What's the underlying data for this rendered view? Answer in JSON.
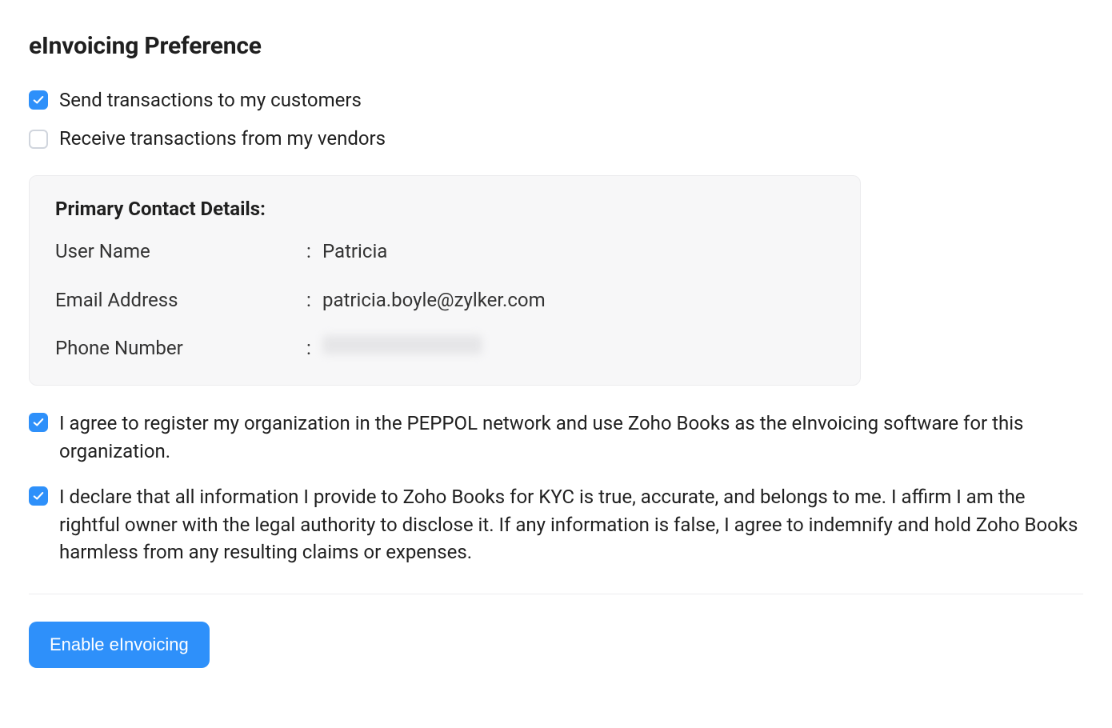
{
  "title": "eInvoicing Preference",
  "options": {
    "send": {
      "label": "Send transactions to my customers",
      "checked": true
    },
    "receive": {
      "label": "Receive transactions from my vendors",
      "checked": false
    }
  },
  "contact": {
    "heading": "Primary Contact Details:",
    "fields": {
      "username": {
        "label": "User Name",
        "value": "Patricia"
      },
      "email": {
        "label": "Email Address",
        "value": "patricia.boyle@zylker.com"
      },
      "phone": {
        "label": "Phone Number",
        "value": ""
      }
    }
  },
  "agreements": {
    "peppol": {
      "text": "I agree to register my organization in the PEPPOL network and use Zoho Books as the eInvoicing software for this organization.",
      "checked": true
    },
    "kyc": {
      "text": "I declare that all information I provide to Zoho Books for KYC is true, accurate, and belongs to me. I affirm I am the rightful owner with the legal authority to disclose it. If any information is false, I agree to indemnify and hold Zoho Books harmless from any resulting claims or expenses.",
      "checked": true
    }
  },
  "actions": {
    "enable": "Enable eInvoicing"
  },
  "separator": ":"
}
